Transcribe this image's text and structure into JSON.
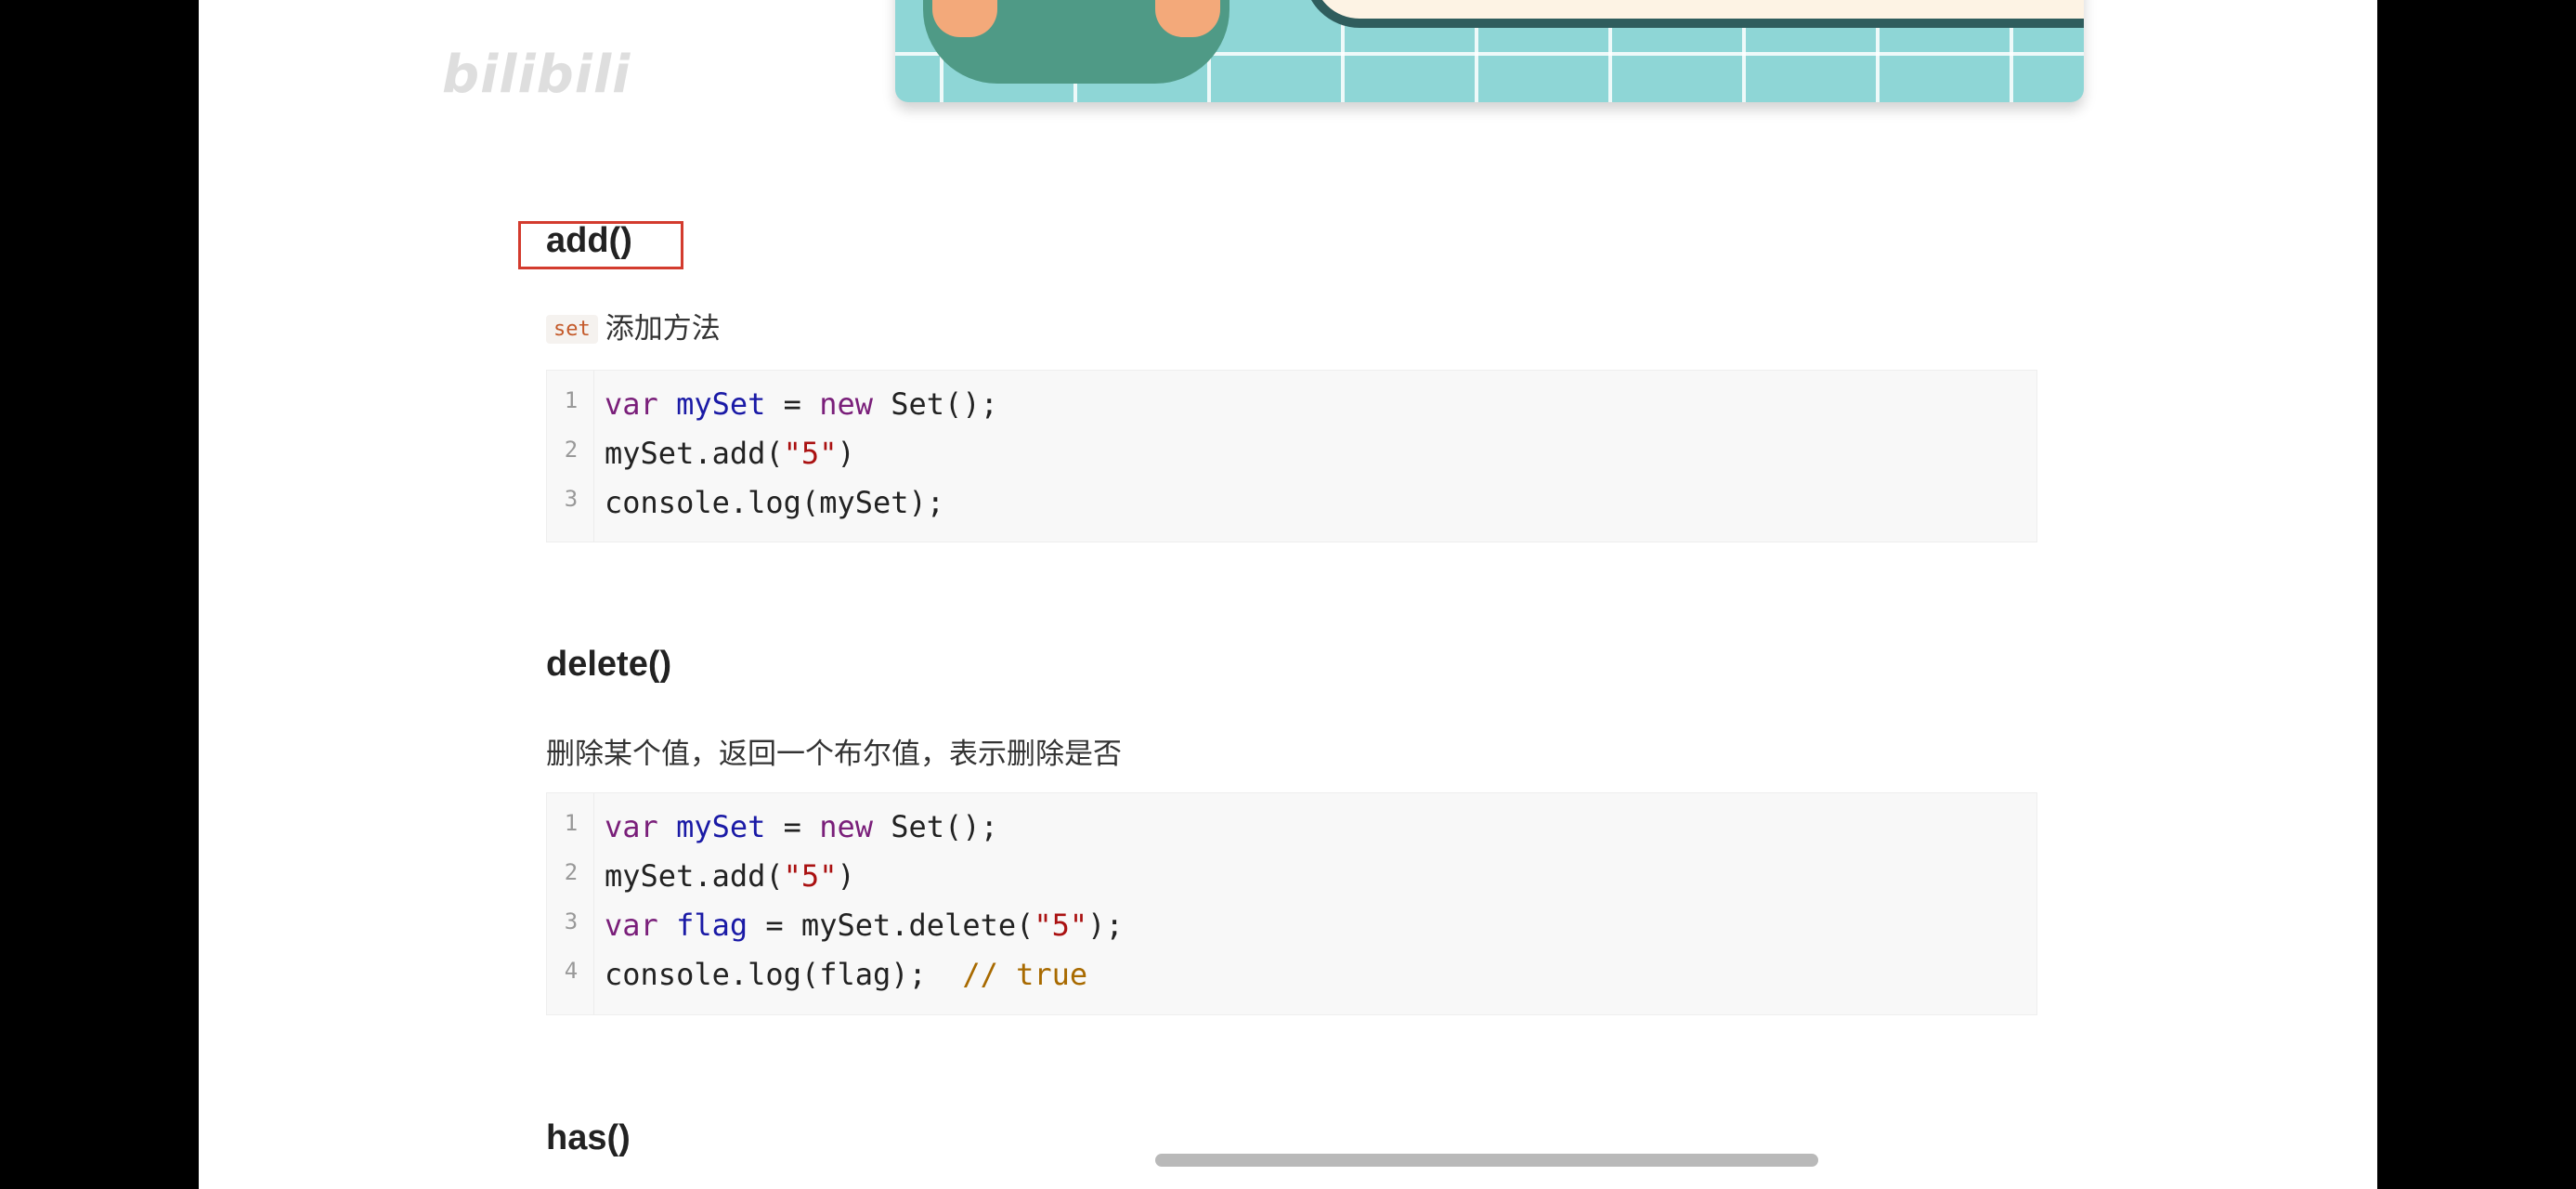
{
  "watermark": {
    "text": "bilibili"
  },
  "sections": {
    "add": {
      "heading": "add()",
      "badge": "set",
      "description": "添加方法",
      "code": [
        {
          "n": "1",
          "parts": [
            [
              "kw",
              "var"
            ],
            [
              "t",
              " "
            ],
            [
              "def",
              "mySet"
            ],
            [
              "t",
              " = "
            ],
            [
              "kw",
              "new"
            ],
            [
              "t",
              " Set();"
            ]
          ]
        },
        {
          "n": "2",
          "parts": [
            [
              "t",
              "mySet.add("
            ],
            [
              "str",
              "\"5\""
            ],
            [
              "t",
              ")"
            ]
          ]
        },
        {
          "n": "3",
          "parts": [
            [
              "t",
              "console.log(mySet);"
            ]
          ]
        }
      ]
    },
    "delete": {
      "heading": "delete()",
      "description": "删除某个值，返回一个布尔值，表示删除是否",
      "code": [
        {
          "n": "1",
          "parts": [
            [
              "kw",
              "var"
            ],
            [
              "t",
              " "
            ],
            [
              "def",
              "mySet"
            ],
            [
              "t",
              " = "
            ],
            [
              "kw",
              "new"
            ],
            [
              "t",
              " Set();"
            ]
          ]
        },
        {
          "n": "2",
          "parts": [
            [
              "t",
              "mySet.add("
            ],
            [
              "str",
              "\"5\""
            ],
            [
              "t",
              ")"
            ]
          ]
        },
        {
          "n": "3",
          "parts": [
            [
              "kw",
              "var"
            ],
            [
              "t",
              " "
            ],
            [
              "def",
              "flag"
            ],
            [
              "t",
              " = mySet.delete("
            ],
            [
              "str",
              "\"5\""
            ],
            [
              "t",
              ");"
            ]
          ]
        },
        {
          "n": "4",
          "parts": [
            [
              "t",
              "console.log(flag);  "
            ],
            [
              "cmt",
              "// true"
            ]
          ]
        }
      ]
    },
    "has": {
      "heading": "has()"
    }
  }
}
